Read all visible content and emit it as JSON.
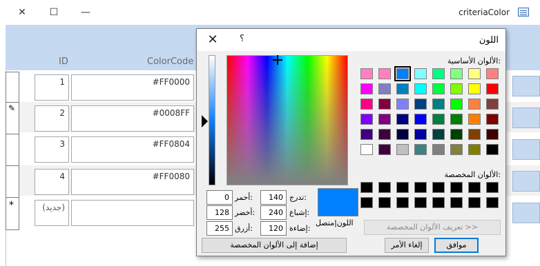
{
  "background_form": {
    "title": "criteriaColor",
    "window_controls": {
      "close": "✕",
      "maximize": "☐",
      "minimize": "—"
    },
    "columns": {
      "id": "ID",
      "colorcode": "ColorCode"
    },
    "rows": [
      {
        "id": "1",
        "colorcode": "#FF0000"
      },
      {
        "id": "2",
        "colorcode": "#0008FF"
      },
      {
        "id": "3",
        "colorcode": "#FF0804"
      },
      {
        "id": "4",
        "colorcode": "#FF0080"
      }
    ],
    "new_record_marker": "*",
    "new_record_label": "(جديد)",
    "edit_marker": "✎"
  },
  "dialog": {
    "title": "اللون",
    "close": "✕",
    "help": "؟",
    "basic_colors_label": "الألوان الأساسية:",
    "custom_colors_label": "الألوان المخصصة:",
    "basic_colors": [
      "#ff80c0",
      "#ff80c0",
      "#0080ff",
      "#80ffff",
      "#00ff80",
      "#80ff80",
      "#ffff80",
      "#ff8080",
      "#ff00ff",
      "#8080c0",
      "#0080c0",
      "#00ffff",
      "#00ff40",
      "#80ff00",
      "#ffff00",
      "#ff0000",
      "#ff0080",
      "#800040",
      "#8080ff",
      "#004080",
      "#008080",
      "#00ff00",
      "#ff8040",
      "#804040",
      "#8000ff",
      "#800080",
      "#000080",
      "#0000ff",
      "#008040",
      "#008000",
      "#ff8000",
      "#800000",
      "#400080",
      "#400040",
      "#000040",
      "#0000a0",
      "#004040",
      "#004000",
      "#804000",
      "#400000",
      "#ffffff",
      "#400040",
      "#c0c0c0",
      "#408080",
      "#808080",
      "#808040",
      "#808000",
      "#000000"
    ],
    "selected_basic_index": 2,
    "custom_colors": [
      "#000000",
      "#000000",
      "#000000",
      "#000000",
      "#000000",
      "#000000",
      "#000000",
      "#000000",
      "#000000",
      "#000000",
      "#000000",
      "#000000",
      "#000000",
      "#000000",
      "#000000",
      "#000000"
    ],
    "define_custom_button": "تعريف الألوان المخصصة >>",
    "ok_button": "موافق",
    "cancel_button": "إلغاء الأمر",
    "add_custom_button": "إضافة إلى الألوان المخصصة",
    "preview_label": "اللون|متصل",
    "preview_color": "#0080ff",
    "fields": {
      "hue": {
        "label": "تدرج:",
        "value": "140"
      },
      "sat": {
        "label": "إشباع:",
        "value": "240"
      },
      "lum": {
        "label": "إضاءة:",
        "value": "120"
      },
      "red": {
        "label": "أحمر:",
        "value": "0"
      },
      "green": {
        "label": "أخضر:",
        "value": "128"
      },
      "blue": {
        "label": "أزرق:",
        "value": "255"
      }
    }
  }
}
